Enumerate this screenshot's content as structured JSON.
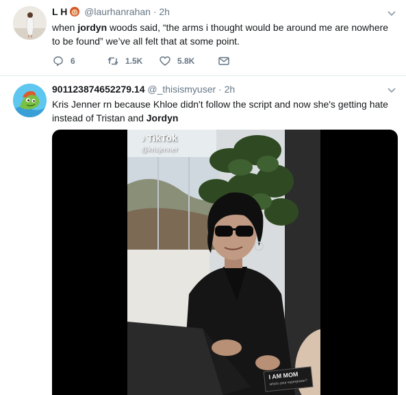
{
  "tweets": [
    {
      "name": "L H",
      "emoji": "woman-red-hair-emoji",
      "handle": "@laurhanrahan",
      "separator": "·",
      "time": "2h",
      "text_parts": [
        "when ",
        "jordyn",
        " woods said, “the arms i thought would be around me are nowhere to be found” we’ve all felt that at some point."
      ],
      "actions": {
        "reply_count": "6",
        "retweet_count": "1.5K",
        "like_count": "5.8K"
      }
    },
    {
      "name": "901123874652279.14",
      "handle": "@_thisismyuser",
      "separator": "·",
      "time": "2h",
      "text_parts": [
        "Kris Jenner rn because Khloe didn't follow the script and now she's getting hate instead of Tristan and ",
        "Jordyn"
      ],
      "media": {
        "watermark_logo": "TikTok",
        "watermark_user": "@krisjenner",
        "sign_line1": "I AM MOM",
        "sign_line2": "what's your superpower?"
      }
    }
  ],
  "colors": {
    "text": "#14171a",
    "secondary": "#657786",
    "divider": "#e6ecf0"
  }
}
